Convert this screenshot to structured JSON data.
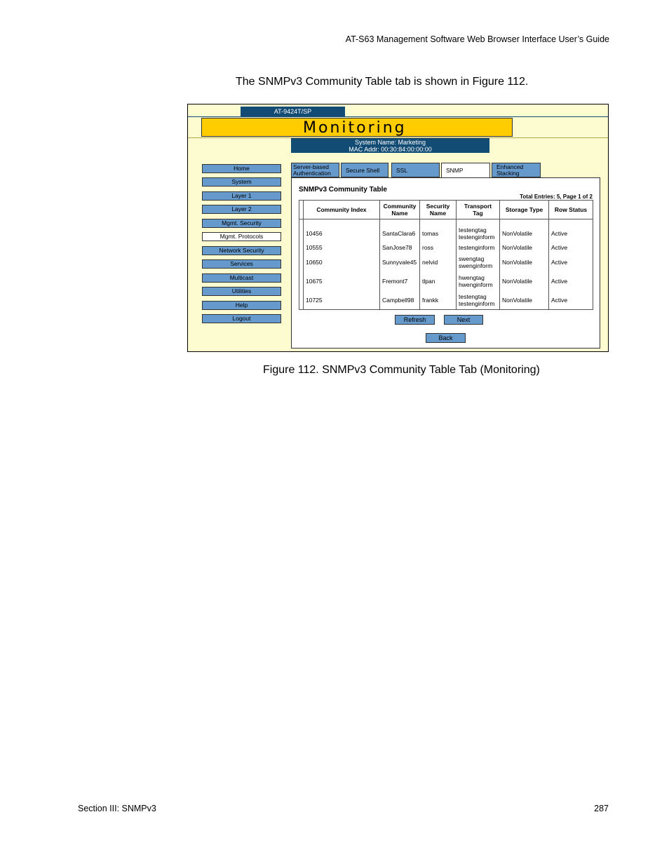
{
  "page": {
    "header": "AT-S63 Management Software Web Browser Interface User’s Guide",
    "intro": "The SNMPv3 Community Table tab is shown in Figure 112.",
    "caption": "Figure 112. SNMPv3 Community Table Tab (Monitoring)",
    "footer_left": "Section III: SNMPv3",
    "footer_right": "287"
  },
  "figure": {
    "model": "AT-9424T/SP",
    "banner": "Monitoring",
    "system_name": "System Name: Marketing",
    "mac_addr": "MAC Addr: 00:30:84:00:00:00",
    "nav": [
      "Home",
      "System",
      "Layer 1",
      "Layer 2",
      "Mgmt. Security",
      "Mgmt. Protocols",
      "Network Security",
      "Services",
      "Multicast",
      "Utilities",
      "Help",
      "Logout"
    ],
    "nav_active": "Mgmt. Protocols",
    "tabs": {
      "server_auth_1": "Server-based",
      "server_auth_2": "Authentication",
      "secure_shell": "Secure Shell",
      "ssl": "SSL",
      "snmp": "SNMP",
      "enhanced_1": "Enhanced",
      "enhanced_2": "Stacking"
    },
    "panel_title": "SNMPv3 Community Table",
    "entries": "Total Entries: 5, Page 1 of 2",
    "columns": [
      "Community Index",
      "Community Name",
      "Security Name",
      "Transport Tag",
      "Storage Type",
      "Row Status"
    ],
    "rows": [
      {
        "index": "10456",
        "community": "SantaClara6",
        "security": "tomas",
        "tag1": "testengtag",
        "tag2": "testenginform",
        "storage": "NonVolatile",
        "status": "Active"
      },
      {
        "index": "10555",
        "community": "SanJose78",
        "security": "ross",
        "tag1": "testenginform",
        "tag2": "",
        "storage": "NonVolatile",
        "status": "Active"
      },
      {
        "index": "10650",
        "community": "Sunnyvale45",
        "security": "nelvid",
        "tag1": "swengtag",
        "tag2": "swenginform",
        "storage": "NonVolatile",
        "status": "Active"
      },
      {
        "index": "10675",
        "community": "Fremont7",
        "security": "tlpan",
        "tag1": "hwengtag",
        "tag2": "hwenginform",
        "storage": "NonVolatile",
        "status": "Active"
      },
      {
        "index": "10725",
        "community": "Campbell98",
        "security": "frankk",
        "tag1": "testengtag",
        "tag2": "testenginform",
        "storage": "NonVolatile",
        "status": "Active"
      }
    ],
    "buttons": {
      "refresh": "Refresh",
      "next": "Next",
      "back": "Back"
    }
  }
}
